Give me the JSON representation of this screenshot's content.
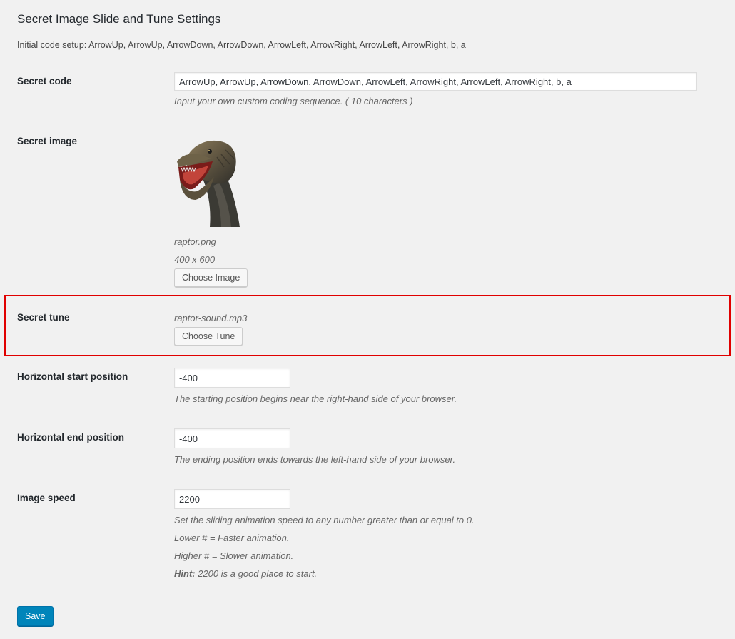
{
  "page": {
    "title": "Secret Image Slide and Tune Settings",
    "intro": "Initial code setup: ArrowUp, ArrowUp, ArrowDown, ArrowDown, ArrowLeft, ArrowRight, ArrowLeft, ArrowRight, b, a"
  },
  "secret_code": {
    "label": "Secret code",
    "value": "ArrowUp, ArrowUp, ArrowDown, ArrowDown, ArrowLeft, ArrowRight, ArrowLeft, ArrowRight, b, a",
    "description": "Input your own custom coding sequence. ( 10 characters )"
  },
  "secret_image": {
    "label": "Secret image",
    "filename": "raptor.png",
    "dimensions": "400 x 600",
    "button_label": "Choose Image"
  },
  "secret_tune": {
    "label": "Secret tune",
    "filename": "raptor-sound.mp3",
    "button_label": "Choose Tune"
  },
  "h_start": {
    "label": "Horizontal start position",
    "value": "-400",
    "description": "The starting position begins near the right-hand side of your browser."
  },
  "h_end": {
    "label": "Horizontal end position",
    "value": "-400",
    "description": "The ending position ends towards the left-hand side of your browser."
  },
  "speed": {
    "label": "Image speed",
    "value": "2200",
    "desc1": "Set the sliding animation speed to any number greater than or equal to 0.",
    "desc2": "Lower # = Faster animation.",
    "desc3": "Higher # = Slower animation.",
    "hint_label": "Hint:",
    "hint_text": " 2200 is a good place to start."
  },
  "save_label": "Save",
  "colors": {
    "highlight": "#e00000",
    "primary_button": "#0085ba",
    "background": "#f1f1f1"
  }
}
